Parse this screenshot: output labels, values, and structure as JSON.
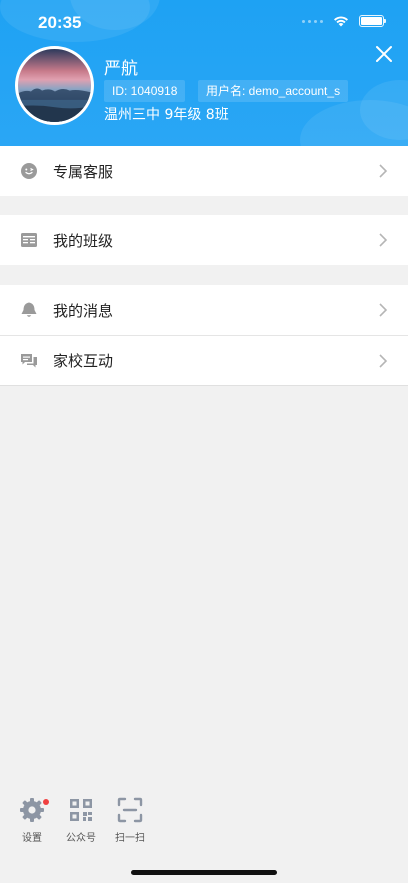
{
  "status_bar": {
    "time": "20:35",
    "icons": [
      "signal-dots-icon",
      "wifi-icon",
      "battery-icon"
    ]
  },
  "header": {
    "colors": {
      "background": "#1ea2f3",
      "text": "#ffffff"
    },
    "close_icon": "close-icon",
    "user": {
      "name": "严航",
      "id_label": "ID: 1040918",
      "username_label": "用户名: demo_account_s",
      "school": "温州三中 9年级 8班"
    }
  },
  "menu": {
    "groups": [
      {
        "items": [
          {
            "label": "专属客服",
            "icon": "support-face-icon"
          }
        ]
      },
      {
        "items": [
          {
            "label": "我的班级",
            "icon": "class-board-icon"
          }
        ]
      },
      {
        "items": [
          {
            "label": "我的消息",
            "icon": "bell-icon"
          },
          {
            "label": "家校互动",
            "icon": "chat-bubbles-icon"
          }
        ]
      }
    ]
  },
  "bottom_bar": {
    "items": [
      {
        "label": "设置",
        "icon": "gear-icon",
        "badge": true
      },
      {
        "label": "公众号",
        "icon": "qr-code-icon"
      },
      {
        "label": "扫一扫",
        "icon": "scan-icon"
      }
    ],
    "badge_color": "#f04040"
  }
}
